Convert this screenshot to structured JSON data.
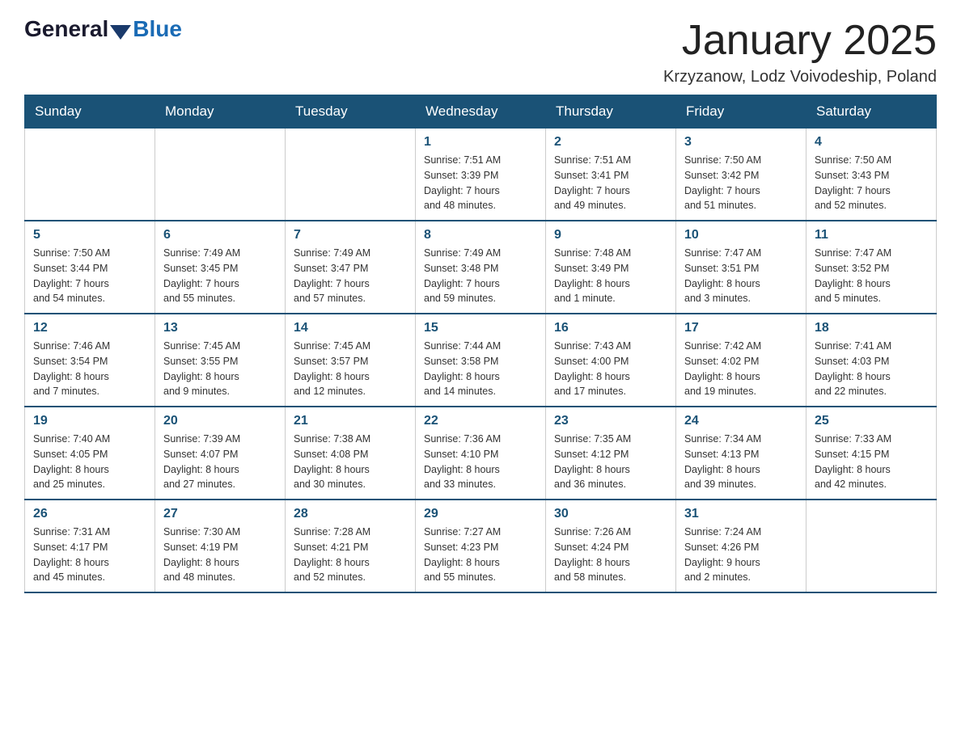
{
  "header": {
    "logo_general": "General",
    "logo_blue": "Blue",
    "title": "January 2025",
    "subtitle": "Krzyzanow, Lodz Voivodeship, Poland"
  },
  "days_of_week": [
    "Sunday",
    "Monday",
    "Tuesday",
    "Wednesday",
    "Thursday",
    "Friday",
    "Saturday"
  ],
  "weeks": [
    [
      {
        "day": "",
        "info": ""
      },
      {
        "day": "",
        "info": ""
      },
      {
        "day": "",
        "info": ""
      },
      {
        "day": "1",
        "info": "Sunrise: 7:51 AM\nSunset: 3:39 PM\nDaylight: 7 hours\nand 48 minutes."
      },
      {
        "day": "2",
        "info": "Sunrise: 7:51 AM\nSunset: 3:41 PM\nDaylight: 7 hours\nand 49 minutes."
      },
      {
        "day": "3",
        "info": "Sunrise: 7:50 AM\nSunset: 3:42 PM\nDaylight: 7 hours\nand 51 minutes."
      },
      {
        "day": "4",
        "info": "Sunrise: 7:50 AM\nSunset: 3:43 PM\nDaylight: 7 hours\nand 52 minutes."
      }
    ],
    [
      {
        "day": "5",
        "info": "Sunrise: 7:50 AM\nSunset: 3:44 PM\nDaylight: 7 hours\nand 54 minutes."
      },
      {
        "day": "6",
        "info": "Sunrise: 7:49 AM\nSunset: 3:45 PM\nDaylight: 7 hours\nand 55 minutes."
      },
      {
        "day": "7",
        "info": "Sunrise: 7:49 AM\nSunset: 3:47 PM\nDaylight: 7 hours\nand 57 minutes."
      },
      {
        "day": "8",
        "info": "Sunrise: 7:49 AM\nSunset: 3:48 PM\nDaylight: 7 hours\nand 59 minutes."
      },
      {
        "day": "9",
        "info": "Sunrise: 7:48 AM\nSunset: 3:49 PM\nDaylight: 8 hours\nand 1 minute."
      },
      {
        "day": "10",
        "info": "Sunrise: 7:47 AM\nSunset: 3:51 PM\nDaylight: 8 hours\nand 3 minutes."
      },
      {
        "day": "11",
        "info": "Sunrise: 7:47 AM\nSunset: 3:52 PM\nDaylight: 8 hours\nand 5 minutes."
      }
    ],
    [
      {
        "day": "12",
        "info": "Sunrise: 7:46 AM\nSunset: 3:54 PM\nDaylight: 8 hours\nand 7 minutes."
      },
      {
        "day": "13",
        "info": "Sunrise: 7:45 AM\nSunset: 3:55 PM\nDaylight: 8 hours\nand 9 minutes."
      },
      {
        "day": "14",
        "info": "Sunrise: 7:45 AM\nSunset: 3:57 PM\nDaylight: 8 hours\nand 12 minutes."
      },
      {
        "day": "15",
        "info": "Sunrise: 7:44 AM\nSunset: 3:58 PM\nDaylight: 8 hours\nand 14 minutes."
      },
      {
        "day": "16",
        "info": "Sunrise: 7:43 AM\nSunset: 4:00 PM\nDaylight: 8 hours\nand 17 minutes."
      },
      {
        "day": "17",
        "info": "Sunrise: 7:42 AM\nSunset: 4:02 PM\nDaylight: 8 hours\nand 19 minutes."
      },
      {
        "day": "18",
        "info": "Sunrise: 7:41 AM\nSunset: 4:03 PM\nDaylight: 8 hours\nand 22 minutes."
      }
    ],
    [
      {
        "day": "19",
        "info": "Sunrise: 7:40 AM\nSunset: 4:05 PM\nDaylight: 8 hours\nand 25 minutes."
      },
      {
        "day": "20",
        "info": "Sunrise: 7:39 AM\nSunset: 4:07 PM\nDaylight: 8 hours\nand 27 minutes."
      },
      {
        "day": "21",
        "info": "Sunrise: 7:38 AM\nSunset: 4:08 PM\nDaylight: 8 hours\nand 30 minutes."
      },
      {
        "day": "22",
        "info": "Sunrise: 7:36 AM\nSunset: 4:10 PM\nDaylight: 8 hours\nand 33 minutes."
      },
      {
        "day": "23",
        "info": "Sunrise: 7:35 AM\nSunset: 4:12 PM\nDaylight: 8 hours\nand 36 minutes."
      },
      {
        "day": "24",
        "info": "Sunrise: 7:34 AM\nSunset: 4:13 PM\nDaylight: 8 hours\nand 39 minutes."
      },
      {
        "day": "25",
        "info": "Sunrise: 7:33 AM\nSunset: 4:15 PM\nDaylight: 8 hours\nand 42 minutes."
      }
    ],
    [
      {
        "day": "26",
        "info": "Sunrise: 7:31 AM\nSunset: 4:17 PM\nDaylight: 8 hours\nand 45 minutes."
      },
      {
        "day": "27",
        "info": "Sunrise: 7:30 AM\nSunset: 4:19 PM\nDaylight: 8 hours\nand 48 minutes."
      },
      {
        "day": "28",
        "info": "Sunrise: 7:28 AM\nSunset: 4:21 PM\nDaylight: 8 hours\nand 52 minutes."
      },
      {
        "day": "29",
        "info": "Sunrise: 7:27 AM\nSunset: 4:23 PM\nDaylight: 8 hours\nand 55 minutes."
      },
      {
        "day": "30",
        "info": "Sunrise: 7:26 AM\nSunset: 4:24 PM\nDaylight: 8 hours\nand 58 minutes."
      },
      {
        "day": "31",
        "info": "Sunrise: 7:24 AM\nSunset: 4:26 PM\nDaylight: 9 hours\nand 2 minutes."
      },
      {
        "day": "",
        "info": ""
      }
    ]
  ]
}
